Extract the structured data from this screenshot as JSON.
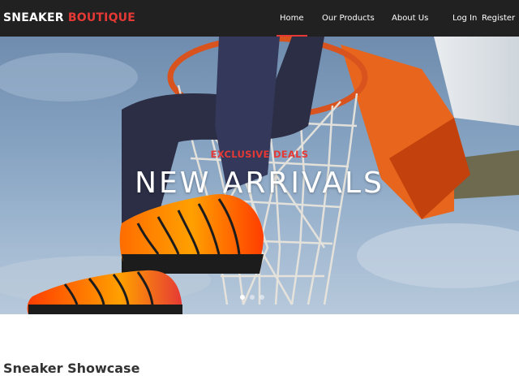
{
  "brand": {
    "primary": "SNEAKER ",
    "accent": "BOUTIQUE"
  },
  "nav": {
    "home": "Home",
    "products": "Our Products",
    "about": "About Us",
    "login": "Log In",
    "register": "Register"
  },
  "hero": {
    "subtitle": "EXCLUSIVE DEALS",
    "title": "NEW ARRIVALS",
    "slides_active": 1
  },
  "section": {
    "title": "Sneaker Showcase"
  },
  "colors": {
    "accent": "#e53935",
    "navbar": "#212121",
    "text": "#333333"
  }
}
